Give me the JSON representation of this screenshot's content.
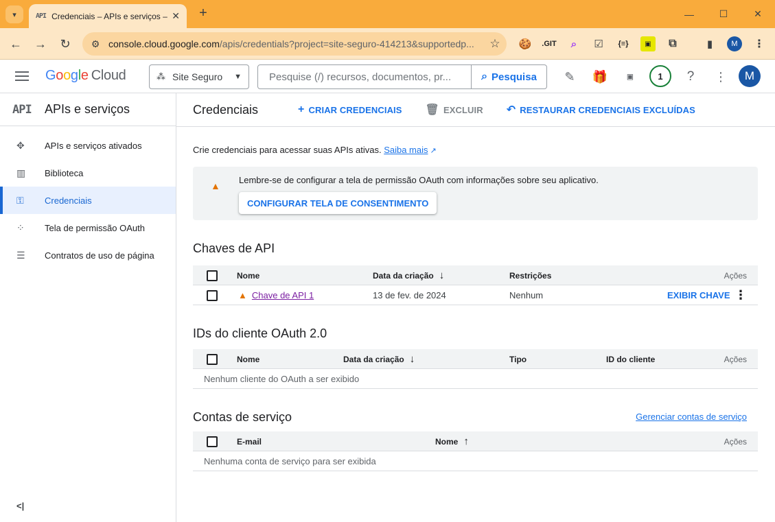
{
  "browser": {
    "tab_favicon": "API",
    "tab_title": "Credenciais – APIs e serviços – S",
    "url_host": "console.cloud.google.com",
    "url_path": "/apis/credentials?project=site-seguro-414213&supportedp...",
    "extensions": [
      ".GIT",
      "{≡}"
    ],
    "profile_initial": "M"
  },
  "header": {
    "product_name": "Cloud",
    "project": "Site Seguro",
    "search_placeholder": "Pesquise (/) recursos, documentos, pr...",
    "search_button": "Pesquisa",
    "notification_count": "1",
    "avatar_initial": "M"
  },
  "sidebar": {
    "logo": "API",
    "title": "APIs e serviços",
    "items": [
      {
        "label": "APIs e serviços ativados",
        "icon": "apis-diamond-icon"
      },
      {
        "label": "Biblioteca",
        "icon": "library-icon"
      },
      {
        "label": "Credenciais",
        "icon": "key-icon",
        "active": true
      },
      {
        "label": "Tela de permissão OAuth",
        "icon": "oauth-dots-icon"
      },
      {
        "label": "Contratos de uso de página",
        "icon": "settings-list-icon"
      }
    ],
    "collapse": "<|"
  },
  "toolbar": {
    "page_title": "Credenciais",
    "create_label": "CRIAR CREDENCIAIS",
    "delete_label": "EXCLUIR",
    "restore_label": "RESTAURAR CREDENCIAIS EXCLUÍDAS"
  },
  "intro": {
    "text": "Crie credenciais para acessar suas APIs ativas. ",
    "link": "Saiba mais"
  },
  "banner": {
    "text": "Lembre-se de configurar a tela de permissão OAuth com informações sobre seu aplicativo.",
    "button": "CONFIGURAR TELA DE CONSENTIMENTO",
    "warning_color": "#e37400"
  },
  "api_keys": {
    "title": "Chaves de API",
    "columns": [
      "Nome",
      "Data da criação",
      "Restrições",
      "Ações"
    ],
    "rows": [
      {
        "name": "Chave de API 1",
        "created": "13 de fev. de 2024",
        "restrictions": "Nenhum",
        "action": "EXIBIR CHAVE"
      }
    ]
  },
  "oauth": {
    "title": "IDs do cliente OAuth 2.0",
    "columns": [
      "Nome",
      "Data da criação",
      "Tipo",
      "ID do cliente",
      "Ações"
    ],
    "empty": "Nenhum cliente do OAuth a ser exibido"
  },
  "service_accounts": {
    "title": "Contas de serviço",
    "manage_link": "Gerenciar contas de serviço",
    "columns": [
      "E-mail",
      "Nome",
      "Ações"
    ],
    "empty": "Nenhuma conta de serviço para ser exibida"
  },
  "colors": {
    "accent": "#1a73e8",
    "chrome_frame": "#f9ab3c",
    "active_nav_bg": "#e8f0fe"
  }
}
